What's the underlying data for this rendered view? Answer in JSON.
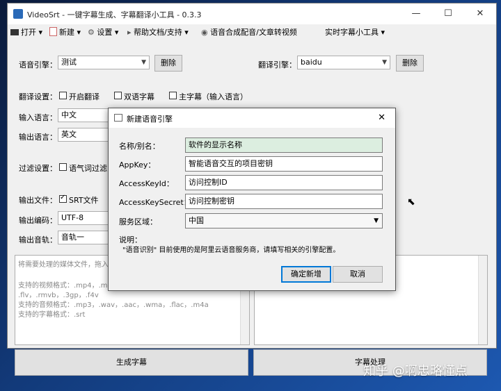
{
  "app": {
    "title": "VideoSrt - 一键字幕生成、字幕翻译小工具 - 0.3.3",
    "icon": "app-icon"
  },
  "window_controls": {
    "minimize": "—",
    "maximize": "☐",
    "close": "✕"
  },
  "menu": {
    "open": "打开",
    "new": "新建",
    "settings": "设置",
    "help": "帮助文档/支持",
    "tts": "语音合成配音/文章转视频",
    "realtime": "实时字幕小工具"
  },
  "form": {
    "speech_engine_label": "语音引擎：",
    "speech_engine_value": "测试",
    "delete_label": "删除",
    "translate_engine_label": "翻译引擎：",
    "translate_engine_value": "baidu",
    "translate_settings_label": "翻译设置：",
    "enable_translate": "开启翻译",
    "bilingual": "双语字幕",
    "main_subtitle": "主字幕（输入语言）",
    "input_lang_label": "输入语言：",
    "input_lang_value": "中文",
    "output_lang_label": "输出语言：",
    "output_lang_value": "英文",
    "filter_label": "过滤设置：",
    "filter_modal": "语气词过滤",
    "output_file_label": "输出文件：",
    "srt_file": "SRT文件",
    "output_encoding_label": "输出编码：",
    "output_encoding_value": "UTF-8",
    "output_track_label": "输出音轨：",
    "output_track_value": "音轨一"
  },
  "drop_panel": {
    "line1": "将需要处理的媒体文件，拖入",
    "line2": "支持的视频格式：.mp4，.mp",
    "line3": ".flv，.rmvb，.3gp，.f4v",
    "line4": "支持的音频格式：.mp3，.wav，.aac，.wma，.flac，.m4a",
    "line5": "支持的字幕格式：.srt"
  },
  "bottom": {
    "generate": "生成字幕",
    "process": "字幕处理"
  },
  "watermark": "知乎 @啊忠略懂点",
  "dialog": {
    "title": "新建语音引擎",
    "close": "✕",
    "name_label": "名称/别名：",
    "name_value": "软件的显示名称",
    "appkey_label": "AppKey：",
    "appkey_value": "智能语音交互的项目密钥",
    "akid_label": "AccessKeyId：",
    "akid_value": "访问控制ID",
    "aksecret_label": "AccessKeySecret：",
    "aksecret_value": "访问控制密钥",
    "region_label": "服务区域：",
    "region_value": "中国",
    "note_title": "说明：",
    "note_text": "\"语音识别\" 目前使用的是阿里云语音服务商，请填写相关的引擎配置。",
    "confirm": "确定新增",
    "cancel": "取消"
  }
}
